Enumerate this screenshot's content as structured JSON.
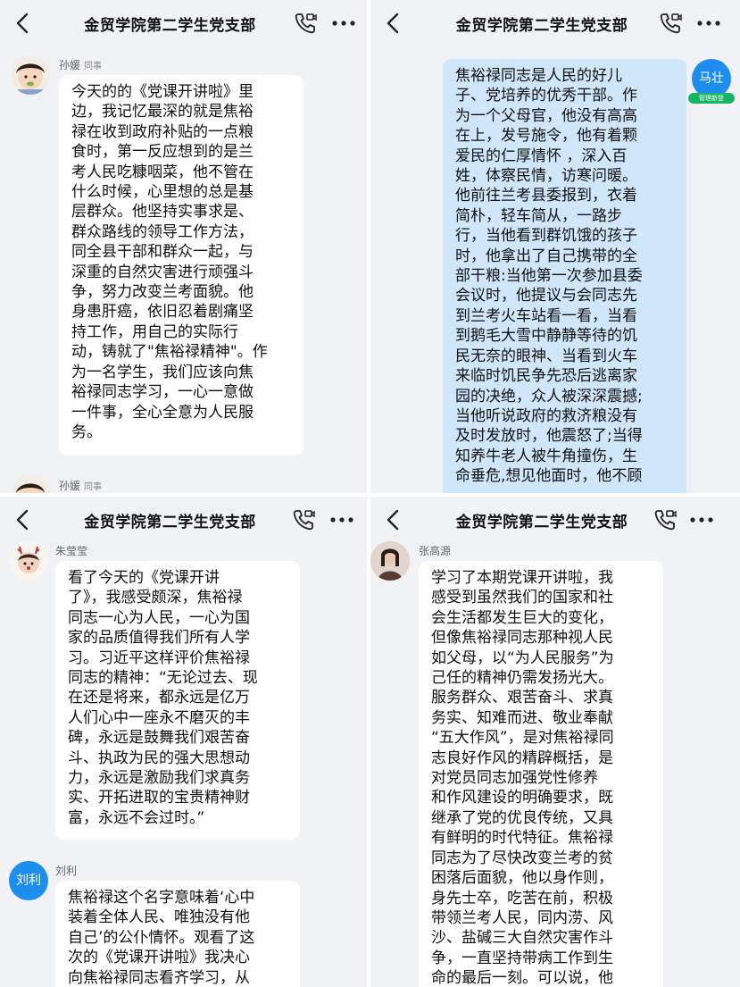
{
  "group_title": "金贸学院第二学生党支部",
  "icons": {
    "back": "chevron-left-icon",
    "call": "video-call-icon",
    "more": "more-dots-icon"
  },
  "colors": {
    "background": "#f1f2f6",
    "bubble": "#ffffff",
    "my_bubble": "#cfe6fb",
    "avatar_blue": "#1e8df0",
    "admin_badge": "#19b566"
  },
  "panel1": {
    "sender": "孙媛",
    "sender_tag": "同事",
    "lines": [
      "今天的的《党课开讲啦》里",
      "边，我记忆最深的就是焦裕",
      "禄在收到政府补贴的一点粮",
      "食时，第一反应想到的是兰",
      "考人民吃糠咽菜，他不管在",
      "什么时候，心里想的总是基",
      "层群众。他坚持实事求是、",
      "群众路线的领导工作方法，",
      "同全县干部和群众一起，与",
      "深重的自然灾害进行顽强斗",
      "争，努力改变兰考面貌。他",
      "身患肝癌，依旧忍着剧痛坚",
      "持工作，用自己的实际行",
      "动，铸就了\"焦裕禄精神\"。作",
      "为一名学生，我们应该向焦",
      "裕禄同志学习，一心一意做",
      "一件事，全心全意为人民服",
      "务。"
    ],
    "next_sender": "孙媛",
    "next_sender_tag": "同事"
  },
  "panel2": {
    "avatar_text": "马壮",
    "admin_badge": "管理新登",
    "lines": [
      "焦裕禄同志是人民的好儿",
      "子、党培养的优秀干部。作",
      "为一个父母官，他没有高高",
      "在上，发号施令，他有着颗",
      "爱民的仁厚情怀 ，深入百",
      "姓，体察民情，访寒问暖。",
      "他前往兰考县委报到，衣着",
      "简朴，轻车简从，一路步",
      "行，当他看到群饥饿的孩子",
      "时，他拿出了自己携带的全",
      "部干粮:当他第一次参加县委",
      "会议时，他提议与会同志先",
      "到兰考火车站看一看，当看",
      "到鹅毛大雪中静静等待的饥",
      "民无奈的眼神、当看到火车",
      "来临时饥民争先恐后逃离家",
      "园的决绝，众人被深深震撼;",
      "当他听说政府的救济粮没有",
      "及时发放时，他震怒了;当得",
      "知养牛老人被牛角撞伤，生",
      "命垂危,想见他面时，他不顾"
    ]
  },
  "panel3": {
    "sender": "朱莹莹",
    "lines": [
      "看了今天的《党课开讲",
      "了》，我感受颇深，焦裕禄",
      "同志一心为人民，一心为国",
      "家的品质值得我们所有人学",
      "习。习近平这样评价焦裕禄",
      "同志的精神：“无论过去、现",
      "在还是将来，都永远是亿万",
      "人们心中一座永不磨灭的丰",
      "碑，永远是鼓舞我们艰苦奋",
      "斗、执政为民的强大思想动",
      "力，永远是激励我们求真务",
      "实、开拓进取的宝贵精神财",
      "富，永远不会过时。”"
    ],
    "second_sender": "刘利",
    "second_avatar_text": "刘利",
    "second_lines": [
      "焦裕禄这个名字意味着‘心中",
      "装着全体人民、唯独没有他",
      "自己’的公仆情怀。观看了这",
      "次的《党课开讲啦》我决心",
      "向焦裕禄同志看齐学习，从"
    ]
  },
  "panel4": {
    "sender": "张高源",
    "lines": [
      "学习了本期党课开讲啦，我",
      "感受到虽然我们的国家和社",
      "会生活都发生巨大的变化，",
      "但像焦裕禄同志那种视人民",
      "如父母，以“为人民服务”为",
      "己任的精神仍需发扬光大。",
      "服务群众、艰苦奋斗、求真",
      "务实、知难而进、敬业奉献",
      "“五大作风”，是对焦裕禄同",
      "志良好作风的精辟概括，是",
      "对党员同志加强党性修养",
      "和作风建设的明确要求，既",
      "继承了党的优良传统，又具",
      "有鲜明的时代特征。焦裕禄",
      "同志为了尽快改变兰考的贫",
      "困落后面貌，他以身作则，",
      "身先士卒，吃苦在前，积极",
      "带领兰考人民，同内涝、风",
      "沙、盐碱三大自然灾害作斗",
      "争，一直坚持带病工作到生",
      "命的最后一刻。可以说，他"
    ]
  }
}
